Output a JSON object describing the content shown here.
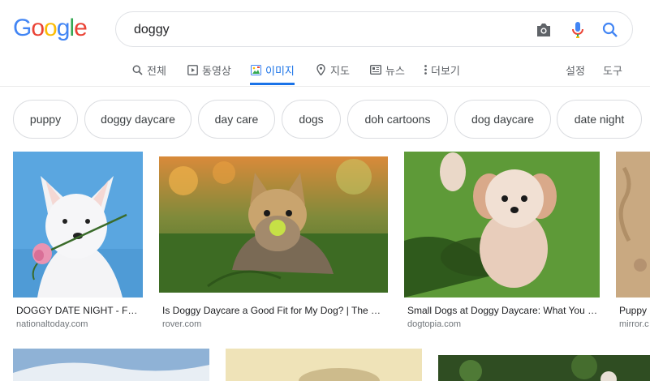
{
  "logo": {
    "text": "Google"
  },
  "search": {
    "query": "doggy",
    "placeholder": ""
  },
  "tabs": [
    {
      "label": "전체",
      "icon": "search-icon"
    },
    {
      "label": "동영상",
      "icon": "video-icon"
    },
    {
      "label": "이미지",
      "icon": "image-icon",
      "active": true
    },
    {
      "label": "지도",
      "icon": "map-pin-icon"
    },
    {
      "label": "뉴스",
      "icon": "news-icon"
    },
    {
      "label": "더보기",
      "icon": "more-vert-icon"
    }
  ],
  "tools": {
    "settings": "설정",
    "tools": "도구"
  },
  "chips": [
    "puppy",
    "doggy daycare",
    "day care",
    "dogs",
    "doh cartoons",
    "dog daycare",
    "date night"
  ],
  "results": [
    {
      "title": "DOGGY DATE NIGHT - Feb…",
      "site": "nationaltoday.com"
    },
    {
      "title": "Is Doggy Daycare a Good Fit for My Dog? | The …",
      "site": "rover.com"
    },
    {
      "title": "Small Dogs at Doggy Daycare: What You …",
      "site": "dogtopia.com"
    },
    {
      "title": "Puppy …",
      "site": "mirror.c…"
    }
  ],
  "colors": {
    "accent": "#1a73e8",
    "text": "#202124",
    "muted": "#5f6368"
  }
}
